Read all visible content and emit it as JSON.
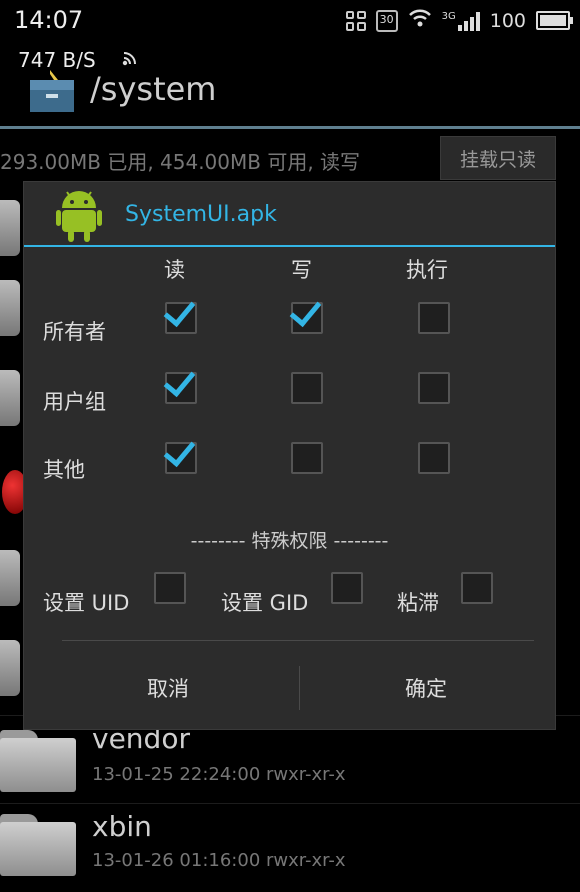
{
  "status_bar": {
    "time": "14:07",
    "carrier_badge": "30",
    "network": "3G",
    "battery": "100",
    "icons": [
      "grid-icon",
      "badge-30-icon",
      "wifi-icon",
      "3g-signal-icon",
      "battery-icon"
    ]
  },
  "notification": {
    "speed": "747 B/S",
    "icon": "rss-icon"
  },
  "app_bar": {
    "title": "/system",
    "icon": "file-manager-icon"
  },
  "storage": {
    "info": "293.00MB 已用, 454.00MB 可用, 读写",
    "mount_button": "挂载只读"
  },
  "files": [
    {
      "name": "vendor",
      "meta": "13-01-25 22:24:00  rwxr-xr-x"
    },
    {
      "name": "xbin",
      "meta": "13-01-26 01:16:00  rwxr-xr-x"
    }
  ],
  "dialog": {
    "title": "SystemUI.apk",
    "icon": "android-icon",
    "columns": [
      "读",
      "写",
      "执行"
    ],
    "rows": [
      {
        "label": "所有者",
        "checks": [
          true,
          true,
          false
        ]
      },
      {
        "label": "用户组",
        "checks": [
          true,
          false,
          false
        ]
      },
      {
        "label": "其他",
        "checks": [
          true,
          false,
          false
        ]
      }
    ],
    "special_header": "-------- 特殊权限 --------",
    "special": [
      {
        "label": "设置 UID",
        "checked": false
      },
      {
        "label": "设置 GID",
        "checked": false
      },
      {
        "label": "粘滞",
        "checked": false
      }
    ],
    "cancel_label": "取消",
    "ok_label": "确定"
  },
  "colors": {
    "accent": "#33b5e5",
    "dialog_bg": "#2c2c2c",
    "background": "#000000"
  }
}
